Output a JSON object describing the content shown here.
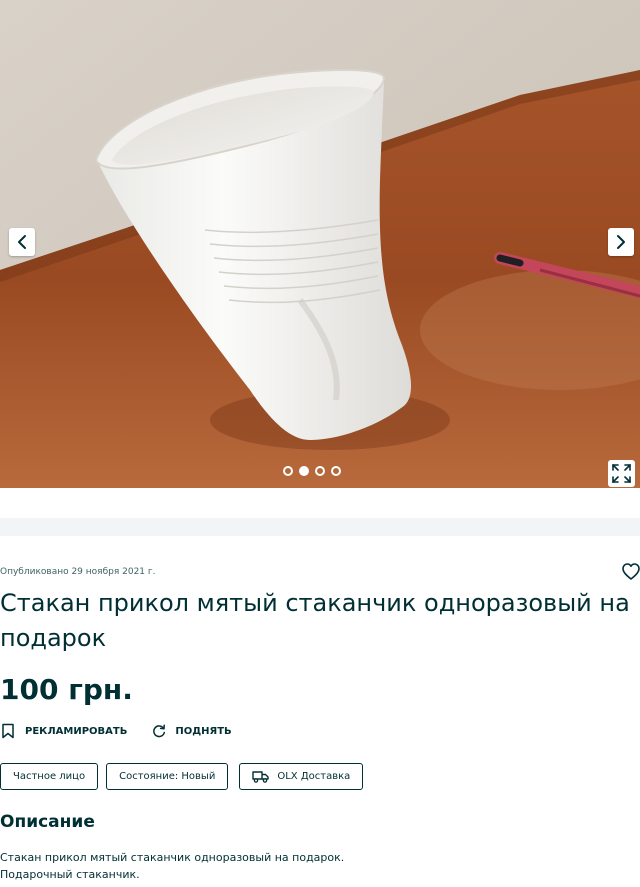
{
  "gallery": {
    "slides_total": 4,
    "active_slide": 2,
    "prev_icon": "chevron-left-icon",
    "next_icon": "chevron-right-icon",
    "fullscreen_icon": "expand-icon"
  },
  "listing": {
    "posted": "Опубликовано 29 ноября 2021 г.",
    "title": "Стакан прикол мятый стаканчик одноразовый на подарок",
    "price": "100 грн."
  },
  "actions": {
    "promote_label": "РЕКЛАМИРОВАТЬ",
    "raise_label": "ПОДНЯТЬ"
  },
  "tags": {
    "seller_type": "Частное лицо",
    "condition": "Состояние: Новый",
    "delivery": "OLX Доставка"
  },
  "description": {
    "heading": "Описание",
    "line1": "Стакан прикол мятый стаканчик одноразовый на подарок.",
    "line2": "Подарочный стаканчик."
  },
  "colors": {
    "text": "#002f34",
    "separator": "#f2f4f5"
  }
}
